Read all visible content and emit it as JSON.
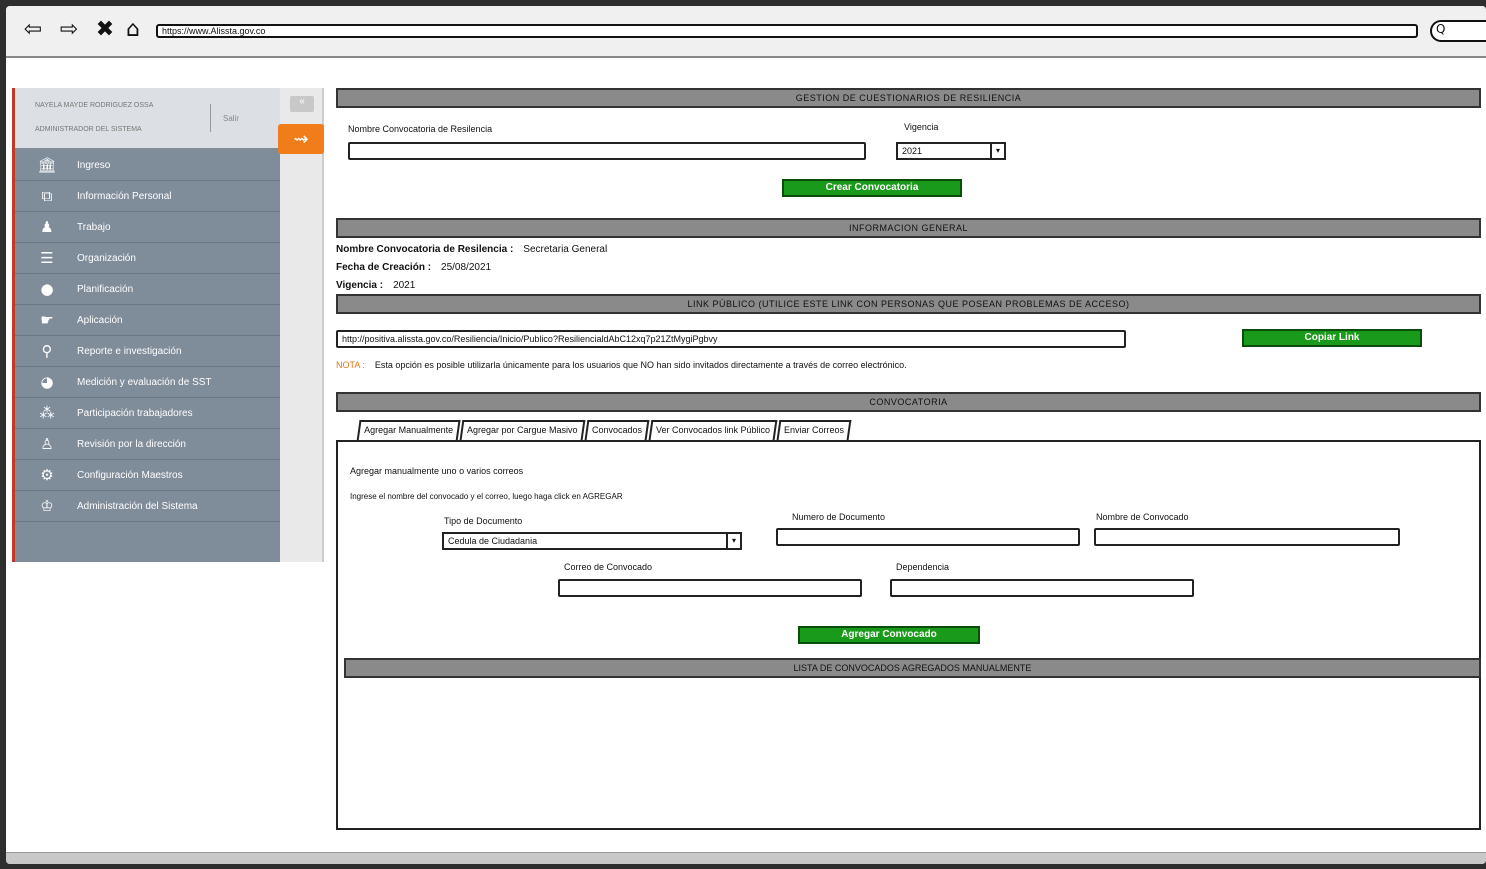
{
  "browser": {
    "url": "https://www.Alissta.gov.co",
    "back_icon": "back-arrow",
    "forward_icon": "forward-arrow",
    "close_icon": "x",
    "home_icon": "home",
    "search_glyph": "Q"
  },
  "sidebar": {
    "user_name": "NAYELA MAYDE RODRIGUEZ OSSA",
    "user_role": "ADMINISTRADOR DEL SISTEMA",
    "logout_label": "Salir",
    "collapse_glyph": "«",
    "items": [
      {
        "label": "Ingreso",
        "icon": "building-icon"
      },
      {
        "label": "Información Personal",
        "icon": "network-icon"
      },
      {
        "label": "Trabajo",
        "icon": "worker-icon"
      },
      {
        "label": "Organización",
        "icon": "list-icon"
      },
      {
        "label": "Planificación",
        "icon": "lightbulb-icon"
      },
      {
        "label": "Aplicación",
        "icon": "hand-icon"
      },
      {
        "label": "Reporte e investigación",
        "icon": "search-icon"
      },
      {
        "label": "Medición y evaluación de SST",
        "icon": "pie-chart-icon"
      },
      {
        "label": "Participación trabajadores",
        "icon": "group-icon"
      },
      {
        "label": "Revisión por la dirección",
        "icon": "user-review-icon"
      },
      {
        "label": "Configuración Maestros",
        "icon": "gear-user-icon"
      },
      {
        "label": "Administración del Sistema",
        "icon": "admin-icon"
      }
    ]
  },
  "gestion": {
    "title": "GESTION DE CUESTIONARIOS DE RESILIENCIA",
    "nombre_label": "Nombre Convocatoria de Resilencia",
    "nombre_value": "",
    "vigencia_label": "Vigencia",
    "vigencia_value": "2021",
    "crear_button": "Crear Convocatoria"
  },
  "info": {
    "title": "INFORMACION GENERAL",
    "nombre_label": "Nombre Convocatoria de Resilencia :",
    "nombre_value": "Secretaria General",
    "fecha_label": "Fecha de Creación :",
    "fecha_value": "25/08/2021",
    "vigencia_label": "Vigencia :",
    "vigencia_value": "2021"
  },
  "link": {
    "title": "LINK PÚBLICO (UTILICE ESTE LINK CON PERSONAS QUE POSEAN PROBLEMAS DE ACCESO)",
    "url_value": "http://positiva.alissta.gov.co/Resiliencia/Inicio/Publico?ResiliencialdAbC12xq7p21ZtMygiPgbvy",
    "copy_button": "Copiar Link",
    "nota_tag": "NOTA :",
    "nota_text": "Esta opción es posible utilizarla únicamente para los usuarios que NO han sido invitados directamente a través de correo electrónico."
  },
  "convocatoria": {
    "title": "CONVOCATORIA",
    "tabs": [
      {
        "label": "Agregar Manualmente"
      },
      {
        "label": "Agregar por Cargue Masivo"
      },
      {
        "label": "Convocados"
      },
      {
        "label": "Ver Convocados link Público"
      },
      {
        "label": "Enviar Correos"
      }
    ],
    "panel": {
      "heading": "Agregar manualmente uno o varios correos",
      "instruction": "Ingrese el nombre del convocado y el correo, luego haga click en AGREGAR",
      "tipo_doc_label": "Tipo de Documento",
      "tipo_doc_value": "Cedula de Ciudadania",
      "numero_doc_label": "Numero de Documento",
      "nombre_conv_label": "Nombre de Convocado",
      "correo_label": "Correo de Convocado",
      "dependencia_label": "Dependencia",
      "agregar_button": "Agregar Convocado",
      "list_title": "LISTA DE CONVOCADOS AGREGADOS MANUALMENTE"
    }
  }
}
